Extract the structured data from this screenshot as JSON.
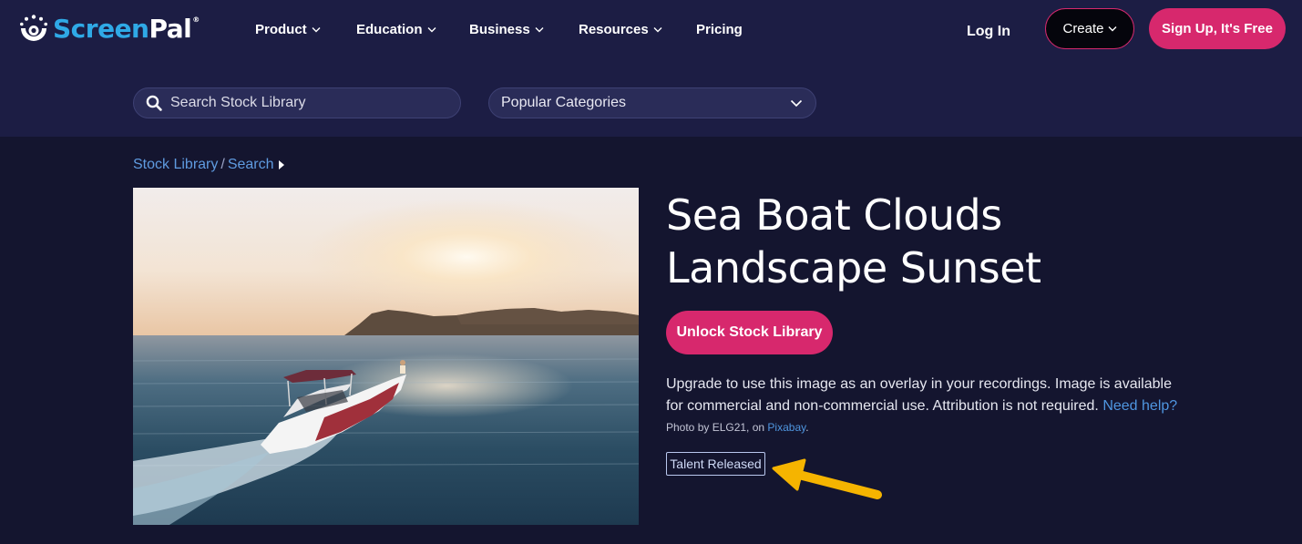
{
  "brand": {
    "name_part1": "Screen",
    "name_part2": "Pal",
    "trademark": "®"
  },
  "nav": {
    "items": [
      {
        "label": "Product",
        "has_dropdown": true
      },
      {
        "label": "Education",
        "has_dropdown": true
      },
      {
        "label": "Business",
        "has_dropdown": true
      },
      {
        "label": "Resources",
        "has_dropdown": true
      },
      {
        "label": "Pricing",
        "has_dropdown": false
      }
    ],
    "login_label": "Log In",
    "create_label": "Create",
    "signup_label": "Sign Up, It's Free"
  },
  "search": {
    "placeholder": "Search Stock Library",
    "value": "",
    "category_label": "Popular Categories"
  },
  "breadcrumb": {
    "root": "Stock Library",
    "separator": "/",
    "current": "Search"
  },
  "asset": {
    "title_line1": "Sea Boat Clouds",
    "title_line2": "Landscape Sunset",
    "unlock_label": "Unlock Stock Library",
    "description": "Upgrade to use this image as an overlay in your recordings. Image is available for commercial and non-commercial use. Attribution is not required.",
    "help_link": "Need help?",
    "credit_prefix": "Photo by ELG21, on",
    "credit_source": "Pixabay",
    "credit_suffix": ".",
    "badge": "Talent Released"
  },
  "colors": {
    "background": "#14152f",
    "header": "#1c1d44",
    "accent_pink": "#d7286d",
    "link_blue": "#4f96e0",
    "brand_blue": "#2fa9e6",
    "annotation_arrow": "#f5b400"
  },
  "icons": {
    "logo": "screenpal-logo-icon",
    "search": "search-icon",
    "dropdown": "chevron-down-icon",
    "breadcrumb_caret": "caret-right-icon",
    "annotation": "arrow-icon"
  }
}
